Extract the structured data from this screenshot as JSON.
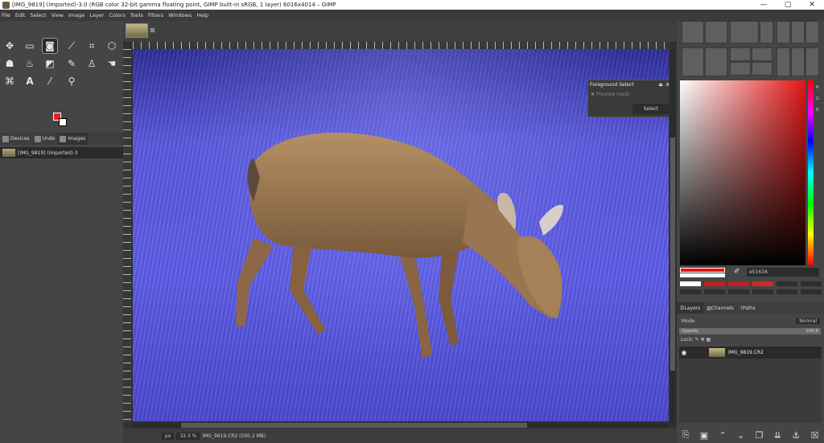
{
  "window": {
    "title": "[IMG_9819] (imported)-3.0 (RGB color 32-bit gamma floating point, GIMP built-in sRGB, 1 layer) 6016x4014 – GIMP",
    "minimize": "—",
    "maximize": "▢",
    "close": "✕"
  },
  "menu": [
    "File",
    "Edit",
    "Select",
    "View",
    "Image",
    "Layer",
    "Colors",
    "Tools",
    "Filters",
    "Windows",
    "Help"
  ],
  "toolbox": {
    "tabs": [
      {
        "label": "Devices"
      },
      {
        "label": "Undo"
      },
      {
        "label": "Images"
      }
    ],
    "image_list_item": "[IMG_9819] (imported)-3",
    "fg_color": "#e8201f",
    "bg_color": "#ffffff"
  },
  "foreground_select": {
    "title": "Foreground Select",
    "preview_label": "Preview mask",
    "select_button": "Select"
  },
  "statusbar": {
    "unit": "px",
    "zoom": "33.3 %",
    "info": "IMG_9819.CR2 (500.2 MB)"
  },
  "color_panel": {
    "hex": "e51616",
    "channels": [
      "R",
      "G",
      "B"
    ]
  },
  "layers": {
    "tabs": [
      "Layers",
      "Channels",
      "Paths"
    ],
    "mode_label": "Mode",
    "mode_value": "Normal",
    "opacity_label": "Opacity",
    "opacity_value": "100.0",
    "lock_label": "Lock:",
    "layer_name": "IMG_9819.CR2"
  }
}
